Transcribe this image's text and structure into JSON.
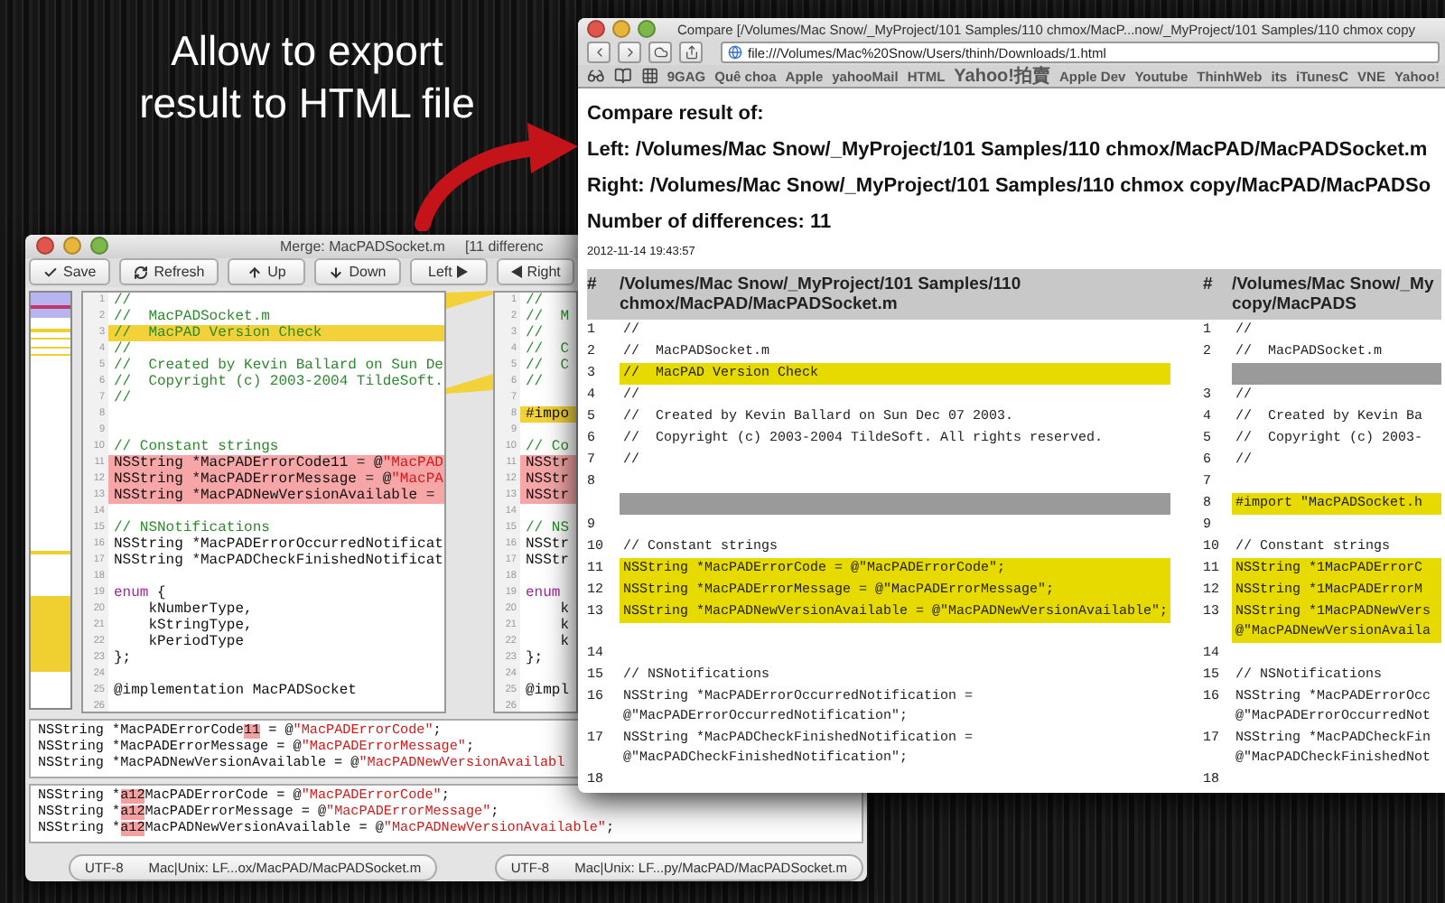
{
  "headline": {
    "lines": [
      "Allow to export",
      "result to HTML file"
    ]
  },
  "merge_window": {
    "title": "Merge: MacPADSocket.m",
    "title_extra": "[11 differenc",
    "toolbar": [
      {
        "label": "Save"
      },
      {
        "label": "Refresh"
      },
      {
        "label": "Up"
      },
      {
        "label": "Down"
      },
      {
        "label": "Left"
      },
      {
        "label": "Right"
      }
    ],
    "left_pane": [
      {
        "n": "1",
        "kind": "plain",
        "parts": [
          {
            "text": "//",
            "kind": "comment"
          }
        ]
      },
      {
        "n": "2",
        "kind": "plain",
        "parts": [
          {
            "text": "//  MacPADSocket.m",
            "kind": "comment"
          }
        ]
      },
      {
        "n": "3",
        "kind": "changed",
        "parts": [
          {
            "text": "//  MacPAD Version Check",
            "kind": "comment"
          }
        ]
      },
      {
        "n": "4",
        "kind": "plain",
        "parts": [
          {
            "text": "//",
            "kind": "comment"
          }
        ]
      },
      {
        "n": "5",
        "kind": "plain",
        "parts": [
          {
            "text": "//  Created by Kevin Ballard on Sun De",
            "kind": "comment"
          }
        ]
      },
      {
        "n": "6",
        "kind": "plain",
        "parts": [
          {
            "text": "//  Copyright (c) 2003-2004 TildeSoft.",
            "kind": "comment"
          }
        ]
      },
      {
        "n": "7",
        "kind": "plain",
        "parts": [
          {
            "text": "//",
            "kind": "comment"
          }
        ]
      },
      {
        "n": "8",
        "kind": "plain"
      },
      {
        "n": "9",
        "kind": "plain"
      },
      {
        "n": "10",
        "kind": "plain",
        "parts": [
          {
            "text": "// Constant strings",
            "kind": "comment"
          }
        ]
      },
      {
        "n": "11",
        "kind": "conflict",
        "parts": [
          {
            "text": "NSString *MacPADErrorCode11 = @",
            "kind": "code"
          },
          {
            "text": "\"MacPAD",
            "kind": "string"
          }
        ]
      },
      {
        "n": "12",
        "kind": "conflict",
        "parts": [
          {
            "text": "NSString *MacPADErrorMessage = @",
            "kind": "code"
          },
          {
            "text": "\"MacPA",
            "kind": "string"
          }
        ]
      },
      {
        "n": "13",
        "kind": "conflict",
        "parts": [
          {
            "text": "NSString *MacPADNewVersionAvailable =",
            "kind": "code"
          }
        ]
      },
      {
        "n": "14",
        "kind": "plain"
      },
      {
        "n": "15",
        "kind": "plain",
        "parts": [
          {
            "text": "// NSNotifications",
            "kind": "comment"
          }
        ]
      },
      {
        "n": "16",
        "kind": "plain",
        "parts": [
          {
            "text": "NSString *MacPADErrorOccurredNotificat",
            "kind": "code"
          }
        ]
      },
      {
        "n": "17",
        "kind": "plain",
        "parts": [
          {
            "text": "NSString *MacPADCheckFinishedNotificat",
            "kind": "code"
          }
        ]
      },
      {
        "n": "18",
        "kind": "plain"
      },
      {
        "n": "19",
        "kind": "plain",
        "parts": [
          {
            "text": "enum",
            "kind": "keyword"
          },
          {
            "text": " {",
            "kind": "code"
          }
        ]
      },
      {
        "n": "20",
        "kind": "plain",
        "parts": [
          {
            "text": "    kNumberType,",
            "kind": "code"
          }
        ]
      },
      {
        "n": "21",
        "kind": "plain",
        "parts": [
          {
            "text": "    kStringType,",
            "kind": "code"
          }
        ]
      },
      {
        "n": "22",
        "kind": "plain",
        "parts": [
          {
            "text": "    kPeriodType",
            "kind": "code"
          }
        ]
      },
      {
        "n": "23",
        "kind": "plain",
        "parts": [
          {
            "text": "};",
            "kind": "code"
          }
        ]
      },
      {
        "n": "24",
        "kind": "plain"
      },
      {
        "n": "25",
        "kind": "plain",
        "parts": [
          {
            "text": "@implementation MacPADSocket",
            "kind": "code"
          }
        ]
      },
      {
        "n": "26",
        "kind": "plain"
      }
    ],
    "right_pane": [
      {
        "n": "1",
        "kind": "plain",
        "parts": [
          {
            "text": "//",
            "kind": "comment"
          }
        ]
      },
      {
        "n": "2",
        "kind": "plain",
        "parts": [
          {
            "text": "//  M",
            "kind": "comment"
          }
        ]
      },
      {
        "n": "3",
        "kind": "plain",
        "parts": [
          {
            "text": "//",
            "kind": "comment"
          }
        ]
      },
      {
        "n": "4",
        "kind": "plain",
        "parts": [
          {
            "text": "//  C",
            "kind": "comment"
          }
        ]
      },
      {
        "n": "5",
        "kind": "plain",
        "parts": [
          {
            "text": "//  C",
            "kind": "comment"
          }
        ]
      },
      {
        "n": "6",
        "kind": "plain",
        "parts": [
          {
            "text": "//",
            "kind": "comment"
          }
        ]
      },
      {
        "n": "7",
        "kind": "plain"
      },
      {
        "n": "8",
        "kind": "changed",
        "parts": [
          {
            "text": "#impo",
            "kind": "code"
          }
        ]
      },
      {
        "n": "9",
        "kind": "plain"
      },
      {
        "n": "10",
        "kind": "plain",
        "parts": [
          {
            "text": "// Co",
            "kind": "comment"
          }
        ]
      },
      {
        "n": "11",
        "kind": "conflict",
        "parts": [
          {
            "text": "NSStr",
            "kind": "code"
          }
        ]
      },
      {
        "n": "12",
        "kind": "conflict",
        "parts": [
          {
            "text": "NSStr",
            "kind": "code"
          }
        ]
      },
      {
        "n": "13",
        "kind": "conflict",
        "parts": [
          {
            "text": "NSStr",
            "kind": "code"
          }
        ]
      },
      {
        "n": "14",
        "kind": "plain"
      },
      {
        "n": "15",
        "kind": "plain",
        "parts": [
          {
            "text": "// NS",
            "kind": "comment"
          }
        ]
      },
      {
        "n": "16",
        "kind": "plain",
        "parts": [
          {
            "text": "NSStr",
            "kind": "code"
          }
        ]
      },
      {
        "n": "17",
        "kind": "plain",
        "parts": [
          {
            "text": "NSStr",
            "kind": "code"
          }
        ]
      },
      {
        "n": "18",
        "kind": "plain"
      },
      {
        "n": "19",
        "kind": "plain",
        "parts": [
          {
            "text": "enum",
            "kind": "keyword"
          }
        ]
      },
      {
        "n": "20",
        "kind": "plain",
        "parts": [
          {
            "text": "    k",
            "kind": "code"
          }
        ]
      },
      {
        "n": "21",
        "kind": "plain",
        "parts": [
          {
            "text": "    k",
            "kind": "code"
          }
        ]
      },
      {
        "n": "22",
        "kind": "plain",
        "parts": [
          {
            "text": "    k",
            "kind": "code"
          }
        ]
      },
      {
        "n": "23",
        "kind": "plain",
        "parts": [
          {
            "text": "};",
            "kind": "code"
          }
        ]
      },
      {
        "n": "24",
        "kind": "plain"
      },
      {
        "n": "25",
        "kind": "plain",
        "parts": [
          {
            "text": "@impl",
            "kind": "code"
          }
        ]
      },
      {
        "n": "26",
        "kind": "plain"
      }
    ],
    "lower_left": [
      [
        {
          "text": "NSString *MacPADErrorCode",
          "kind": "code"
        },
        {
          "text": "11",
          "kind": "diff"
        },
        {
          "text": " = @",
          "kind": "code"
        },
        {
          "text": "\"MacPADErrorCode\"",
          "kind": "string"
        },
        {
          "text": ";",
          "kind": "code"
        }
      ],
      [
        {
          "text": "NSString *MacPADErrorMessage = @",
          "kind": "code"
        },
        {
          "text": "\"MacPADErrorMessage\"",
          "kind": "string"
        },
        {
          "text": ";",
          "kind": "code"
        }
      ],
      [
        {
          "text": "NSString *MacPADNewVersionAvailable = @",
          "kind": "code"
        },
        {
          "text": "\"MacPADNewVersionAvailabl",
          "kind": "string"
        }
      ]
    ],
    "lower_right": [
      [
        {
          "text": "NSString *",
          "kind": "code"
        },
        {
          "text": "a12",
          "kind": "diff"
        },
        {
          "text": "MacPADErrorCode = @",
          "kind": "code"
        },
        {
          "text": "\"MacPADErrorCode\"",
          "kind": "string"
        },
        {
          "text": ";",
          "kind": "code"
        }
      ],
      [
        {
          "text": "NSString *",
          "kind": "code"
        },
        {
          "text": "a12",
          "kind": "diff"
        },
        {
          "text": "MacPADErrorMessage = @",
          "kind": "code"
        },
        {
          "text": "\"MacPADErrorMessage\"",
          "kind": "string"
        },
        {
          "text": ";",
          "kind": "code"
        }
      ],
      [
        {
          "text": "NSString *",
          "kind": "code"
        },
        {
          "text": "a12",
          "kind": "diff"
        },
        {
          "text": "MacPADNewVersionAvailable = @",
          "kind": "code"
        },
        {
          "text": "\"MacPADNewVersionAvailable\"",
          "kind": "string"
        },
        {
          "text": ";",
          "kind": "code"
        }
      ]
    ],
    "status_bar": [
      {
        "encoding": "UTF-8",
        "path": "Mac|Unix: LF...ox/MacPAD/MacPADSocket.m"
      },
      {
        "encoding": "UTF-8",
        "path": "Mac|Unix: LF...py/MacPAD/MacPADSocket.m"
      }
    ]
  },
  "browser": {
    "title": "Compare [/Volumes/Mac Snow/_MyProject/101 Samples/110 chmox/MacP...now/_MyProject/101 Samples/110 chmox copy",
    "address": "file:///Volumes/Mac%20Snow/Users/thinh/Downloads/1.html",
    "bookmarks": [
      "9GAG",
      "Quê choa",
      "Apple",
      "yahooMail",
      "HTML",
      "Yahoo!拍賣",
      "Apple Dev",
      "Youtube",
      "ThinhWeb",
      "its",
      "iTunesC",
      "VNE",
      "Yahoo!"
    ],
    "page": {
      "heading": "Compare result of:",
      "left": "Left: /Volumes/Mac Snow/_MyProject/101 Samples/110 chmox/MacPAD/MacPADSocket.m",
      "right": "Right: /Volumes/Mac Snow/_MyProject/101 Samples/110 chmox copy/MacPAD/MacPADSo",
      "count": "Number of differences: 11",
      "date": "2012-11-14 19:43:57",
      "columns": [
        {
          "label": "#"
        },
        {
          "label": "/Volumes/Mac Snow/_MyProject/101 Samples/110 chmox/MacPAD/MacPADSocket.m"
        },
        {
          "label": "#"
        },
        {
          "lines": [
            "/Volumes/Mac Snow/_My",
            "copy/MacPADS"
          ]
        }
      ],
      "rows": [
        {
          "left": {
            "n": "1",
            "text": "//",
            "kind": "plain"
          },
          "right": {
            "n": "1",
            "text": "//",
            "kind": "plain"
          }
        },
        {
          "left": {
            "n": "2",
            "text": "//  MacPADSocket.m",
            "kind": "plain"
          },
          "right": {
            "n": "2",
            "text": "//  MacPADSocket.m",
            "kind": "plain"
          }
        },
        {
          "left": {
            "n": "3",
            "text": "//  MacPAD Version Check",
            "kind": "changed"
          },
          "right": {
            "kind": "gap"
          }
        },
        {
          "left": {
            "n": "4",
            "text": "//",
            "kind": "plain"
          },
          "right": {
            "n": "3",
            "text": "//",
            "kind": "plain"
          }
        },
        {
          "left": {
            "n": "5",
            "text": "//  Created by Kevin Ballard on Sun Dec 07 2003.",
            "kind": "plain"
          },
          "right": {
            "n": "4",
            "text": "//  Created by Kevin Ba",
            "kind": "plain"
          }
        },
        {
          "left": {
            "n": "6",
            "text": "//  Copyright (c) 2003-2004 TildeSoft. All rights reserved.",
            "kind": "plain"
          },
          "right": {
            "n": "5",
            "text": "//  Copyright (c) 2003-",
            "kind": "plain"
          }
        },
        {
          "left": {
            "n": "7",
            "text": "//",
            "kind": "plain"
          },
          "right": {
            "n": "6",
            "text": "//",
            "kind": "plain"
          }
        },
        {
          "left": {
            "n": "8",
            "kind": "plain"
          },
          "right": {
            "n": "7",
            "kind": "plain"
          }
        },
        {
          "left": {
            "kind": "gap"
          },
          "right": {
            "n": "8",
            "text": "#import \"MacPADSocket.h",
            "kind": "changed"
          }
        },
        {
          "left": {
            "n": "9",
            "kind": "plain"
          },
          "right": {
            "n": "9",
            "kind": "plain"
          }
        },
        {
          "left": {
            "n": "10",
            "text": "// Constant strings",
            "kind": "plain"
          },
          "right": {
            "n": "10",
            "text": "// Constant strings",
            "kind": "plain"
          }
        },
        {
          "left": {
            "n": "11",
            "text": "NSString *MacPADErrorCode = @\"MacPADErrorCode\";",
            "kind": "changed"
          },
          "right": {
            "n": "11",
            "text": "NSString *1MacPADErrorC",
            "kind": "changed"
          }
        },
        {
          "left": {
            "n": "12",
            "text": "NSString *MacPADErrorMessage = @\"MacPADErrorMessage\";",
            "kind": "changed"
          },
          "right": {
            "n": "12",
            "text": "NSString *1MacPADErrorM",
            "kind": "changed"
          }
        },
        {
          "left": {
            "n": "13",
            "text": "NSString *MacPADNewVersionAvailable = @\"MacPADNewVersionAvailable\";",
            "kind": "changed"
          },
          "right": {
            "n": "13",
            "text": "NSString *1MacPADNewVers\n@\"MacPADNewVersionAvaila",
            "kind": "changed"
          }
        },
        {
          "left": {
            "n": "14",
            "kind": "plain"
          },
          "right": {
            "n": "14",
            "kind": "plain"
          }
        },
        {
          "left": {
            "n": "15",
            "text": "// NSNotifications",
            "kind": "plain"
          },
          "right": {
            "n": "15",
            "text": "// NSNotifications",
            "kind": "plain"
          }
        },
        {
          "left": {
            "n": "16",
            "text": "NSString *MacPADErrorOccurredNotification =\n@\"MacPADErrorOccurredNotification\";",
            "kind": "plain"
          },
          "right": {
            "n": "16",
            "text": "NSString *MacPADErrorOcc\n@\"MacPADErrorOccurredNot",
            "kind": "plain"
          }
        },
        {
          "left": {
            "n": "17",
            "text": "NSString *MacPADCheckFinishedNotification =\n@\"MacPADCheckFinishedNotification\";",
            "kind": "plain"
          },
          "right": {
            "n": "17",
            "text": "NSString *MacPADCheckFin\n@\"MacPADCheckFinishedNot",
            "kind": "plain"
          }
        },
        {
          "left": {
            "n": "18",
            "kind": "plain"
          },
          "right": {
            "n": "18",
            "kind": "plain"
          }
        }
      ]
    }
  }
}
